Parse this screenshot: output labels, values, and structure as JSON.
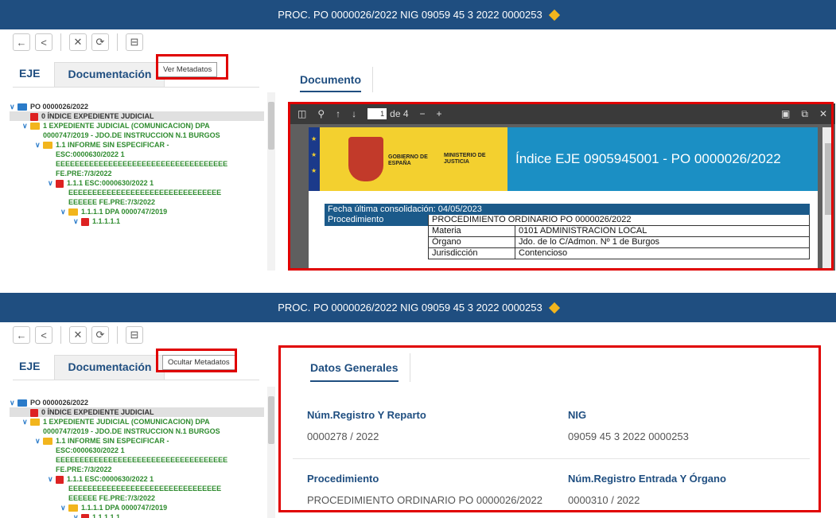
{
  "title": "PROC. PO 0000026/2022 NIG 09059 45 3 2022 0000253",
  "toolbar": {
    "back": "←",
    "prev": "<",
    "close": "✕",
    "refresh": "⟳",
    "panel": "⊟"
  },
  "tabs": {
    "eje": "EJE",
    "documentacion": "Documentación"
  },
  "top": {
    "meta_button": "Ver Metadatos",
    "right_tab": "Documento"
  },
  "bottom": {
    "meta_button": "Ocultar Metadatos",
    "right_tab": "Datos Generales"
  },
  "tree": [
    {
      "level": 0,
      "icon": "blue-folder",
      "text": "PO 0000026/2022",
      "color": "dark"
    },
    {
      "level": 1,
      "icon": "pdf",
      "text": "0 ÍNDICE EXPEDIENTE JUDICIAL",
      "color": "sel"
    },
    {
      "level": 1,
      "icon": "folder",
      "text": "1 EXPEDIENTE JUDICIAL (COMUNICACION) DPA",
      "color": "green"
    },
    {
      "level": 1,
      "icon": "",
      "text": "0000747/2019 - JDO.DE INSTRUCCION N.1 BURGOS",
      "color": "green"
    },
    {
      "level": 2,
      "icon": "folder",
      "text": "1.1 INFORME SIN ESPECIFICAR -",
      "color": "green"
    },
    {
      "level": 2,
      "icon": "",
      "text": "ESC:0000630/2022 1",
      "color": "green"
    },
    {
      "level": 2,
      "icon": "",
      "text": "EEEEEEEEEEEEEEEEEEEEEEEEEEEEEEEEEEEE",
      "color": "green"
    },
    {
      "level": 2,
      "icon": "",
      "text": "FE.PRE:7/3/2022",
      "color": "green"
    },
    {
      "level": 3,
      "icon": "pdf",
      "text": "1.1.1 ESC:0000630/2022 1",
      "color": "green"
    },
    {
      "level": 3,
      "icon": "",
      "text": "EEEEEEEEEEEEEEEEEEEEEEEEEEEEEEEE",
      "color": "green"
    },
    {
      "level": 3,
      "icon": "",
      "text": "EEEEEE FE.PRE:7/3/2022",
      "color": "green"
    },
    {
      "level": 4,
      "icon": "folder",
      "text": "1.1.1.1 DPA 0000747/2019",
      "color": "green"
    },
    {
      "level": 5,
      "icon": "pdf",
      "text": "1.1.1.1.1",
      "color": "green"
    }
  ],
  "viewer": {
    "page_number": "1",
    "page_of": "de 4",
    "gobierno": "GOBIERNO DE ESPAÑA",
    "ministerio": "MINISTERIO DE JUSTICIA",
    "index_title": "Índice EJE 0905945001 - PO  0000026/2022",
    "consolidacion": "Fecha última consolidación: 04/05/2023",
    "procedimiento_label": "Procedimiento",
    "procedimiento_value": "PROCEDIMIENTO ORDINARIO PO  0000026/2022",
    "rows": [
      {
        "k": "Materia",
        "v": "0101  ADMINISTRACION LOCAL"
      },
      {
        "k": "Órgano",
        "v": "Jdo. de lo C/Admon. Nº 1 de Burgos"
      },
      {
        "k": "Jurisdicción",
        "v": "Contencioso"
      }
    ]
  },
  "datos": {
    "reg_reparto_label": "Núm.Registro Y Reparto",
    "reg_reparto_value": "0000278 / 2022",
    "nig_label": "NIG",
    "nig_value": "09059 45 3 2022 0000253",
    "proc_label": "Procedimiento",
    "proc_value": "PROCEDIMIENTO ORDINARIO PO 0000026/2022",
    "reg_entrada_label": "Núm.Registro Entrada Y Órgano",
    "reg_entrada_value": "0000310 / 2022"
  },
  "colors": {
    "brand": "#1f4e80",
    "highlight": "#e00000",
    "tree_green": "#2e8b2e",
    "diamond": "#f2b51d"
  }
}
